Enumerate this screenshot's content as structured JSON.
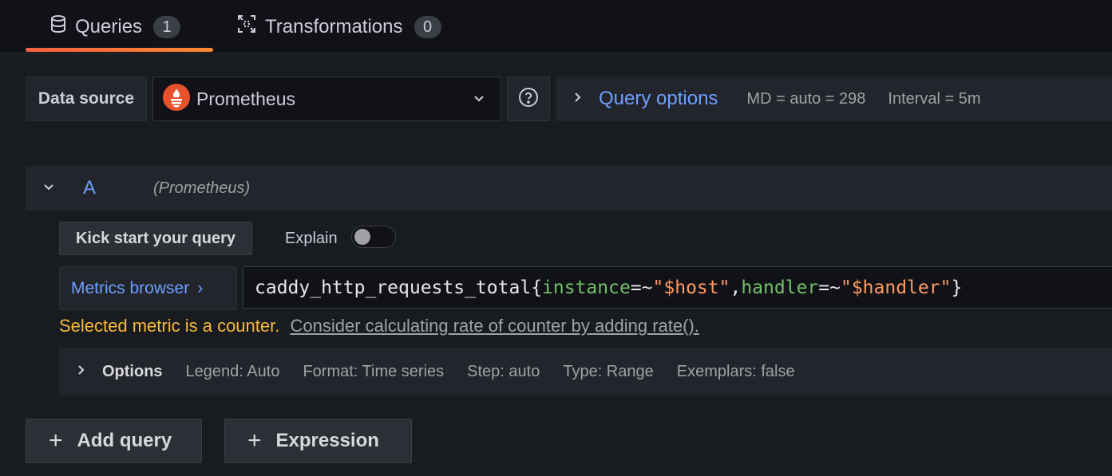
{
  "tabs": [
    {
      "label": "Queries",
      "count": "1",
      "icon": "database-icon",
      "active": true
    },
    {
      "label": "Transformations",
      "count": "0",
      "icon": "transform-icon",
      "active": false
    }
  ],
  "colors": {
    "accent_underline": "#f55f3e",
    "link": "#6e9fff",
    "warning": "#f8b93c",
    "label_token": "#73bf69",
    "string_token": "#ff9a62",
    "prometheus_logo": "#e6522c"
  },
  "datasource": {
    "label": "Data source",
    "selected": "Prometheus",
    "icon": "prometheus-logo-icon"
  },
  "query_options": {
    "title": "Query options",
    "md": "MD = auto = 298",
    "interval": "Interval = 5m"
  },
  "query_a": {
    "ref_id": "A",
    "datasource_hint": "(Prometheus)",
    "kick_start_label": "Kick start your query",
    "explain_label": "Explain",
    "explain_enabled": false,
    "metrics_browser_label": "Metrics browser",
    "metrics_browser_chevron": "›",
    "expr": {
      "metric": "caddy_http_requests_total",
      "open_brace": "{",
      "label1": "instance",
      "op1": "=~",
      "value1": "\"$host\"",
      "comma": ",",
      "label2": "handler",
      "op2": "=~",
      "value2": "\"$handler\"",
      "close_brace": "}"
    },
    "hint_warning": "Selected metric is a counter.",
    "hint_fix": "Consider calculating rate of counter by adding rate().",
    "options": {
      "title": "Options",
      "legend": "Legend: Auto",
      "format": "Format: Time series",
      "step": "Step: auto",
      "type": "Type: Range",
      "exemplars": "Exemplars: false"
    }
  },
  "actions": {
    "add_query": "Add query",
    "expression": "Expression",
    "plus": "+"
  }
}
